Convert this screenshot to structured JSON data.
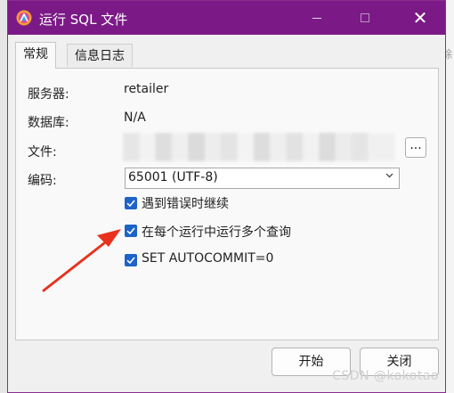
{
  "window": {
    "title": "运行 SQL 文件"
  },
  "tabs": [
    {
      "label": "常规",
      "active": true
    },
    {
      "label": "信息日志",
      "active": false
    }
  ],
  "form": {
    "server_label": "服务器:",
    "server_value": "retailer",
    "database_label": "数据库:",
    "database_value": "N/A",
    "file_label": "文件:",
    "file_value": "",
    "browse_label": "...",
    "encoding_label": "编码:",
    "encoding_value": "65001 (UTF-8)"
  },
  "checkboxes": [
    {
      "label": "遇到错误时继续",
      "checked": true
    },
    {
      "label": "在每个运行中运行多个查询",
      "checked": true
    },
    {
      "label": "SET AUTOCOMMIT=0",
      "checked": true
    }
  ],
  "buttons": {
    "start": "开始",
    "close": "关闭"
  },
  "background": {
    "right_glyph": "除"
  },
  "watermark": "CSDN @kokotao",
  "colors": {
    "titlebar": "#7b1a86",
    "checkbox": "#1e63c8",
    "annotation_arrow": "#e8321e"
  },
  "icons": {
    "app": "navicat-icon",
    "browse": "ellipsis",
    "dropdown": "chevron-down-icon"
  }
}
